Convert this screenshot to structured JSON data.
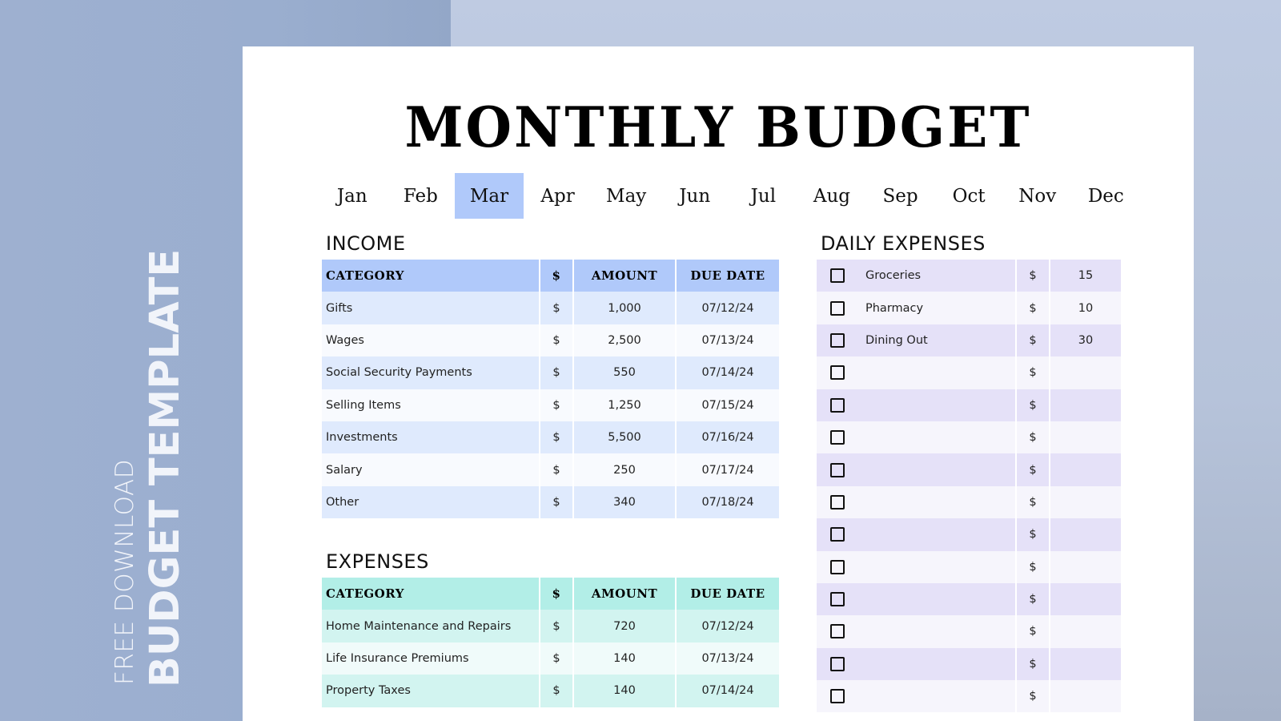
{
  "side_banner": {
    "line1": "FREE DOWNLOAD",
    "line2": "BUDGET TEMPLATE"
  },
  "document": {
    "title": "MONTHLY BUDGET",
    "months": [
      "Jan",
      "Feb",
      "Mar",
      "Apr",
      "May",
      "Jun",
      "Jul",
      "Aug",
      "Sep",
      "Oct",
      "Nov",
      "Dec"
    ],
    "selected_month": "Mar"
  },
  "colors": {
    "income_header": "#b0c9fa",
    "expenses_header": "#b2eee7",
    "daily_row": "#e5e1f8",
    "selected_month": "#b0c9fa"
  },
  "income": {
    "title": "INCOME",
    "headers": [
      "CATEGORY",
      "$",
      "AMOUNT",
      "DUE DATE"
    ],
    "rows": [
      {
        "category": "Gifts",
        "currency": "$",
        "amount": "1,000",
        "due_date": "07/12/24"
      },
      {
        "category": "Wages",
        "currency": "$",
        "amount": "2,500",
        "due_date": "07/13/24"
      },
      {
        "category": "Social Security Payments",
        "currency": "$",
        "amount": "550",
        "due_date": "07/14/24"
      },
      {
        "category": "Selling Items",
        "currency": "$",
        "amount": "1,250",
        "due_date": "07/15/24"
      },
      {
        "category": "Investments",
        "currency": "$",
        "amount": "5,500",
        "due_date": "07/16/24"
      },
      {
        "category": "Salary",
        "currency": "$",
        "amount": "250",
        "due_date": "07/17/24"
      },
      {
        "category": "Other",
        "currency": "$",
        "amount": "340",
        "due_date": "07/18/24"
      }
    ]
  },
  "expenses": {
    "title": "EXPENSES",
    "headers": [
      "CATEGORY",
      "$",
      "AMOUNT",
      "DUE DATE"
    ],
    "rows": [
      {
        "category": "Home Maintenance and Repairs",
        "currency": "$",
        "amount": "720",
        "due_date": "07/12/24"
      },
      {
        "category": "Life Insurance Premiums",
        "currency": "$",
        "amount": "140",
        "due_date": "07/13/24"
      },
      {
        "category": "Property Taxes",
        "currency": "$",
        "amount": "140",
        "due_date": "07/14/24"
      }
    ]
  },
  "daily_expenses": {
    "title": "DAILY EXPENSES",
    "rows": [
      {
        "item": "Groceries",
        "currency": "$",
        "amount": "15",
        "checked": false
      },
      {
        "item": "Pharmacy",
        "currency": "$",
        "amount": "10",
        "checked": false
      },
      {
        "item": "Dining Out",
        "currency": "$",
        "amount": "30",
        "checked": false
      },
      {
        "item": "",
        "currency": "$",
        "amount": "",
        "checked": false
      },
      {
        "item": "",
        "currency": "$",
        "amount": "",
        "checked": false
      },
      {
        "item": "",
        "currency": "$",
        "amount": "",
        "checked": false
      },
      {
        "item": "",
        "currency": "$",
        "amount": "",
        "checked": false
      },
      {
        "item": "",
        "currency": "$",
        "amount": "",
        "checked": false
      },
      {
        "item": "",
        "currency": "$",
        "amount": "",
        "checked": false
      },
      {
        "item": "",
        "currency": "$",
        "amount": "",
        "checked": false
      },
      {
        "item": "",
        "currency": "$",
        "amount": "",
        "checked": false
      },
      {
        "item": "",
        "currency": "$",
        "amount": "",
        "checked": false
      },
      {
        "item": "",
        "currency": "$",
        "amount": "",
        "checked": false
      },
      {
        "item": "",
        "currency": "$",
        "amount": "",
        "checked": false
      }
    ]
  }
}
